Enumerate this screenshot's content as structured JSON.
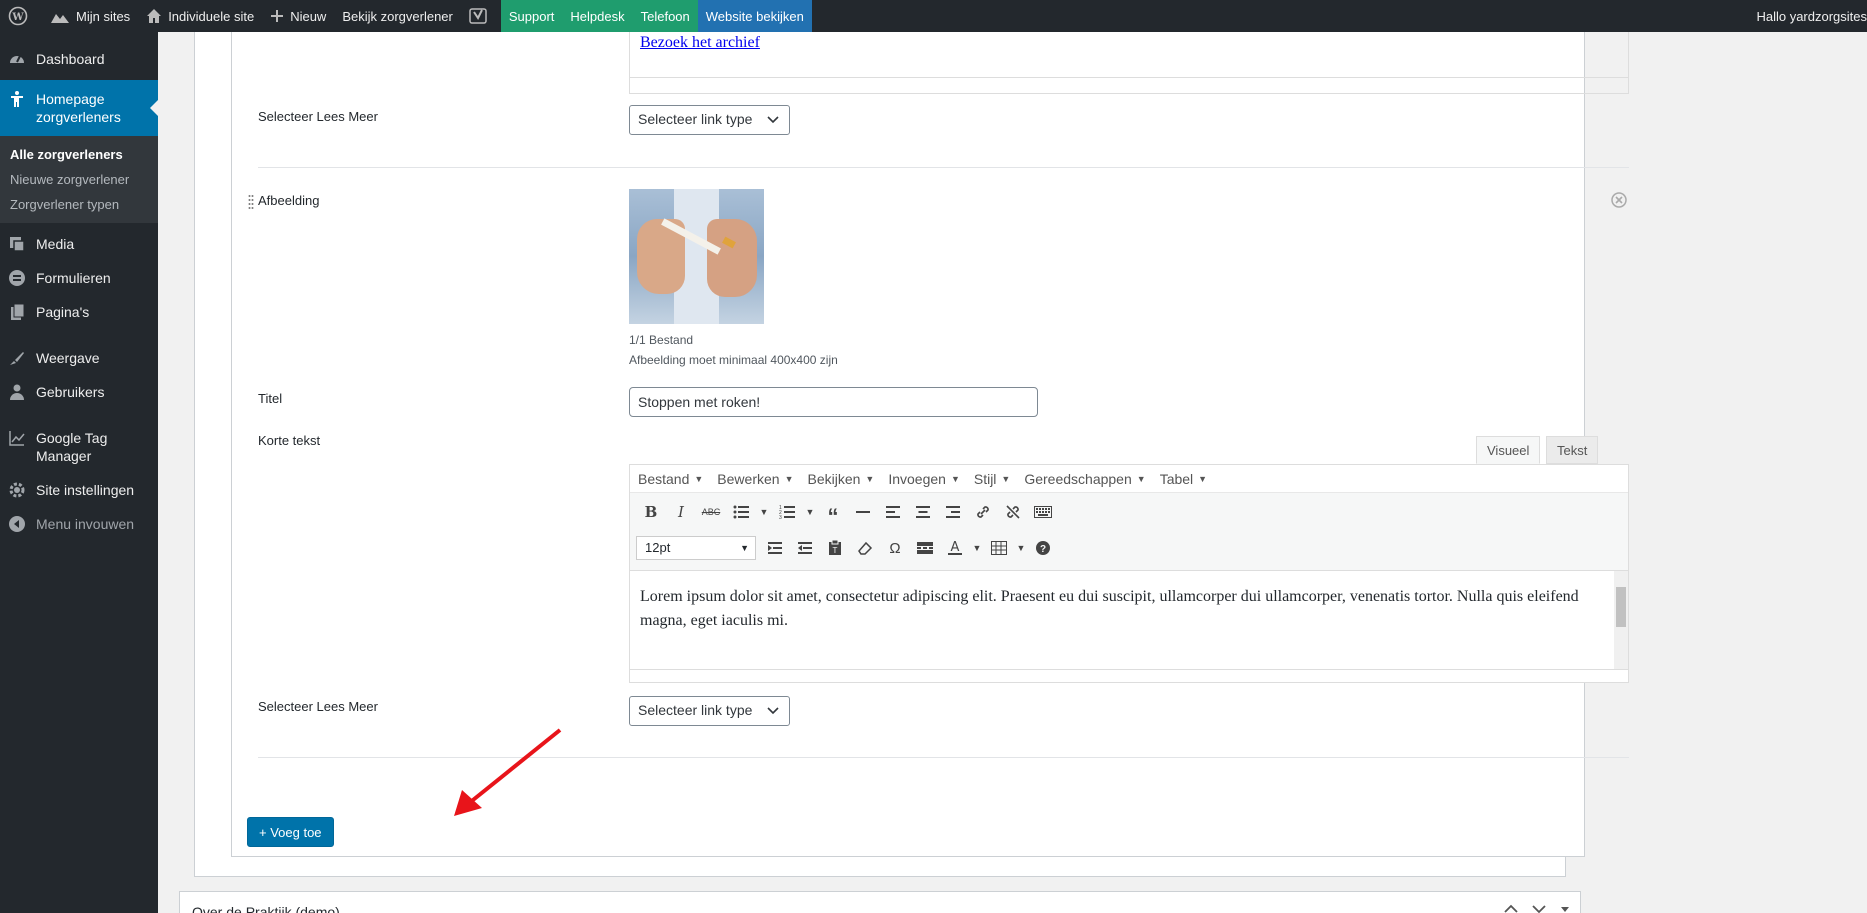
{
  "adminbar": {
    "my_sites": "Mijn sites",
    "site": "Individuele site",
    "new": "Nieuw",
    "view_providers": "Bekijk zorgverlener",
    "support": "Support",
    "helpdesk": "Helpdesk",
    "phone": "Telefoon",
    "view_site": "Website bekijken",
    "greeting": "Hallo yardzorgsites"
  },
  "sidebar": {
    "dashboard": "Dashboard",
    "homepage": "Homepage zorgverleners",
    "sub": [
      "Alle zorgverleners",
      "Nieuwe zorgverlener",
      "Zorgverlener typen"
    ],
    "media": "Media",
    "forms": "Formulieren",
    "pages": "Pagina's",
    "appearance": "Weergave",
    "users": "Gebruikers",
    "gtm": "Google Tag Manager",
    "site_settings": "Site instellingen",
    "collapse": "Menu invouwen"
  },
  "form": {
    "archive_link": "Bezoek het archief",
    "read_more_label_1": "Selecteer Lees Meer",
    "link_type_select_1": "Selecteer link type",
    "image_label": "Afbeelding",
    "file_count": "1/1 Bestand",
    "image_hint": "Afbeelding moet minimaal 400x400 zijn",
    "title_label": "Titel",
    "title_value": "Stoppen met roken!",
    "short_text_label": "Korte tekst",
    "tab_visual": "Visueel",
    "tab_text": "Tekst",
    "menu": [
      "Bestand",
      "Bewerken",
      "Bekijken",
      "Invoegen",
      "Stijl",
      "Gereedschappen",
      "Tabel"
    ],
    "font_size": "12pt",
    "body_text": "Lorem ipsum dolor sit amet, consectetur adipiscing elit. Praesent eu dui suscipit, ullamcorper dui ullamcorper, venenatis tortor. Nulla quis eleifend magna, eget iaculis mi.",
    "read_more_label_2": "Selecteer Lees Meer",
    "link_type_select_2": "Selecteer link type",
    "add_button": "+ Voeg toe"
  },
  "next_box": {
    "title": "Over de Praktijk (demo)"
  },
  "colors": {
    "admin_dark": "#23282d",
    "accent_blue": "#0073aa",
    "green": "#1f9d6e",
    "arrow_red": "#e8141a"
  }
}
